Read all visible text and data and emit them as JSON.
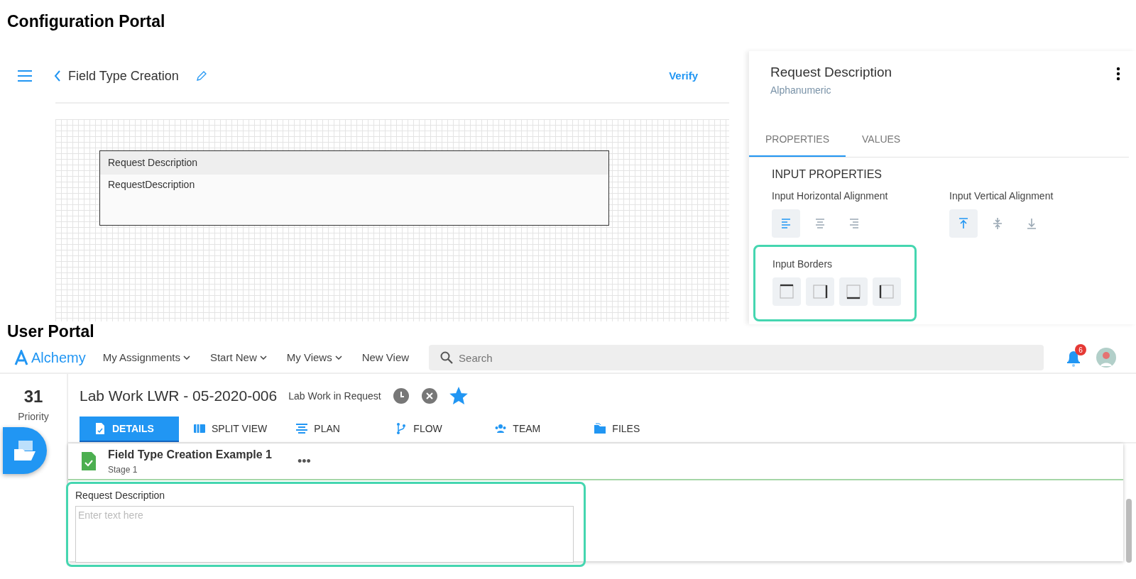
{
  "config_portal": {
    "heading": "Configuration Portal",
    "header": {
      "title": "Field Type Creation",
      "action": "Verify"
    },
    "canvas_field": {
      "label": "Request Description",
      "value": "RequestDescription"
    },
    "panel": {
      "title": "Request Description",
      "subtitle": "Alphanumeric",
      "tabs": [
        {
          "label": "PROPERTIES",
          "selected": true
        },
        {
          "label": "VALUES",
          "selected": false
        }
      ],
      "section_title": "INPUT PROPERTIES",
      "horizontal_alignment": {
        "label": "Input Horizontal Alignment",
        "options": [
          {
            "kind": "left",
            "selected": true
          },
          {
            "kind": "center",
            "selected": false
          },
          {
            "kind": "right",
            "selected": false
          }
        ]
      },
      "vertical_alignment": {
        "label": "Input Vertical Alignment",
        "options": [
          {
            "kind": "top",
            "selected": true
          },
          {
            "kind": "middle",
            "selected": false
          },
          {
            "kind": "bottom",
            "selected": false
          }
        ]
      },
      "input_borders": {
        "label": "Input Borders",
        "options": [
          {
            "kind": "top"
          },
          {
            "kind": "right"
          },
          {
            "kind": "bottom"
          },
          {
            "kind": "left"
          }
        ]
      }
    }
  },
  "user_portal": {
    "heading": "User Portal",
    "brand": "Alchemy",
    "menus": [
      {
        "label": "My Assignments",
        "dropdown": true
      },
      {
        "label": "Start New",
        "dropdown": true
      },
      {
        "label": "My Views",
        "dropdown": true
      },
      {
        "label": "New View",
        "dropdown": false
      }
    ],
    "search": {
      "placeholder": "Search"
    },
    "notifications": "6",
    "priority": {
      "value": "31",
      "label": "Priority"
    },
    "record": {
      "title": "Lab Work LWR - 05-2020-006",
      "status": "Lab Work in Request",
      "starred": true
    },
    "tabs": [
      {
        "label": "DETAILS",
        "kind": "details",
        "selected": true
      },
      {
        "label": "SPLIT VIEW",
        "kind": "split",
        "selected": false
      },
      {
        "label": "PLAN",
        "kind": "plan",
        "selected": false
      },
      {
        "label": "FLOW",
        "kind": "flow",
        "selected": false
      },
      {
        "label": "TEAM",
        "kind": "team",
        "selected": false
      },
      {
        "label": "FILES",
        "kind": "files",
        "selected": false
      }
    ],
    "form": {
      "title": "Field Type Creation Example 1",
      "stage": "Stage 1",
      "more": "•••",
      "field": {
        "label": "Request Description",
        "placeholder": "Enter text here"
      }
    }
  }
}
